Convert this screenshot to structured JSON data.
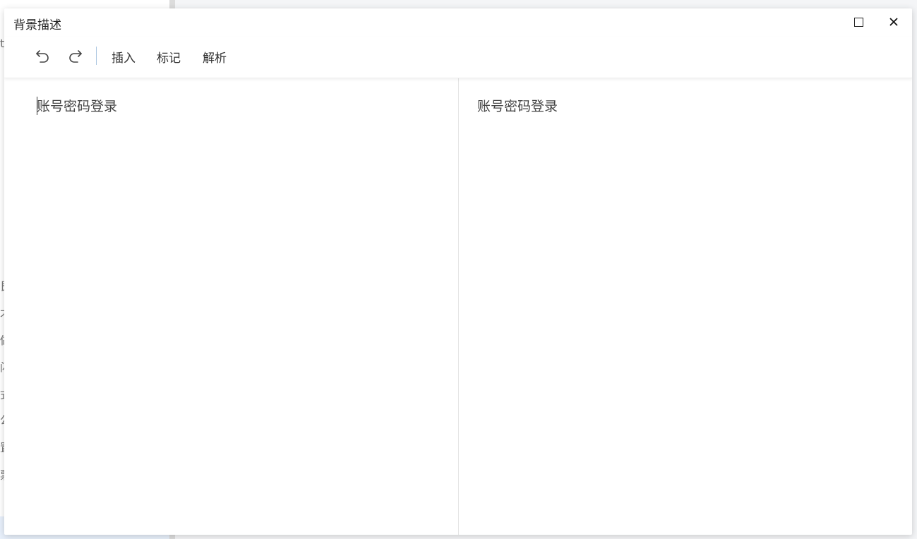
{
  "background": {
    "side_glyphs": [
      "t",
      "艮",
      "才",
      "做",
      "闪",
      "式",
      "公",
      "置",
      "票"
    ]
  },
  "dialog": {
    "title": "背景描述",
    "maximize_icon": "maximize-icon",
    "close_icon": "close-icon",
    "close_glyph": "✕"
  },
  "toolbar": {
    "undo_icon": "undo-icon",
    "redo_icon": "redo-icon",
    "insert_label": "插入",
    "mark_label": "标记",
    "parse_label": "解析",
    "separator_color": "#a9c4e0"
  },
  "editor": {
    "source_text": "账号密码登录"
  },
  "preview": {
    "rendered_text": "账号密码登录"
  }
}
